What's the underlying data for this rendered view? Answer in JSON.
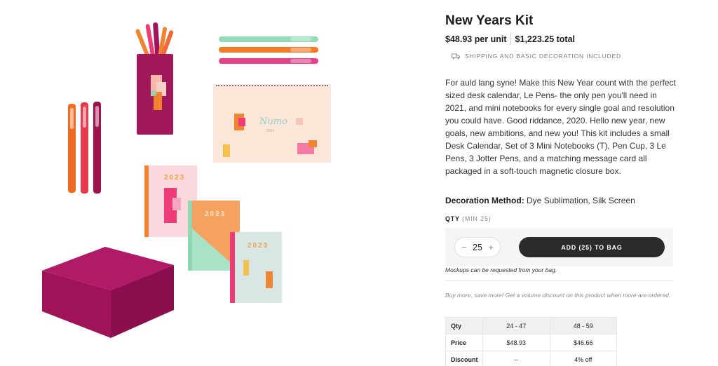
{
  "product": {
    "title": "New Years Kit",
    "price_per_unit": "$48.93 per unit",
    "price_total": "$1,223.25 total",
    "shipping_note": "SHIPPING AND BASIC DECORATION INCLUDED",
    "description": "For auld lang syne! Make this New Year count with the perfect sized desk calendar, Le Pens- the only pen you'll need in 2021, and mini notebooks for every single goal and resolution you could have. Good riddance, 2020. Hello new year, new goals, new ambitions, and new you! This kit includes a small Desk Calendar, Set of 3 Mini Notebooks (T), Pen Cup, 3 Le Pens, 3 Jotter Pens, and a matching message card all packaged in a soft-touch magnetic closure box.",
    "decoration_label": "Decoration Method:",
    "decoration_value": "Dye Sublimation, Silk Screen"
  },
  "quantity": {
    "label": "QTY",
    "min_note": "(MIN 25)",
    "decrement": "−",
    "increment": "+",
    "value": "25",
    "add_button": "ADD (25) TO BAG",
    "mockup_note": "Mockups can be requested from your bag."
  },
  "volume": {
    "intro": "Buy more, save more! Get a volume discount on this product when more are ordered.",
    "rows": [
      {
        "label": "Qty",
        "cells": [
          "24 - 47",
          "48 - 59"
        ]
      },
      {
        "label": "Price",
        "cells": [
          "$48.93",
          "$46.66"
        ]
      },
      {
        "label": "Discount",
        "cells": [
          "--",
          "4% off"
        ]
      }
    ]
  },
  "gallery": {
    "calendar_logo": "Numo",
    "calendar_year": "2024",
    "notebook_year": "2023",
    "icons": [
      "truck-icon"
    ]
  },
  "colors": {
    "magenta": "#A3125C",
    "orange": "#F08431",
    "pink": "#EE3C76",
    "mint": "#8FD6B4",
    "peach": "#FBE3D4",
    "dark": "#2B2B2B"
  }
}
